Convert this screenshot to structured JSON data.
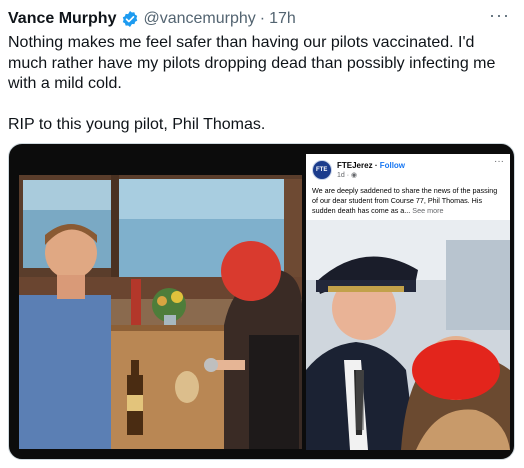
{
  "tweet": {
    "display_name": "Vance Murphy",
    "handle": "@vancemurphy",
    "separator": "·",
    "time": "17h",
    "more_label": "···",
    "text": "Nothing makes me feel safer than having our pilots vaccinated. I'd much rather have my pilots dropping dead than possibly infecting me with a mild cold.\n\nRIP to this young pilot, Phil Thomas.",
    "verified_color": "#1d9bf0",
    "icons": [
      "verified-badge-icon",
      "more-icon"
    ]
  },
  "facebook_post": {
    "page_name": "FTEJerez",
    "follow_label": "Follow",
    "time": "1d",
    "separator": "·",
    "avatar_text": "FTE",
    "more_label": "···",
    "text": "We are deeply saddened to share the news of the passing of our dear student from Course 77, Phil Thomas. His sudden death has come as a...",
    "see_more": "See more",
    "link_color": "#1877f2"
  }
}
